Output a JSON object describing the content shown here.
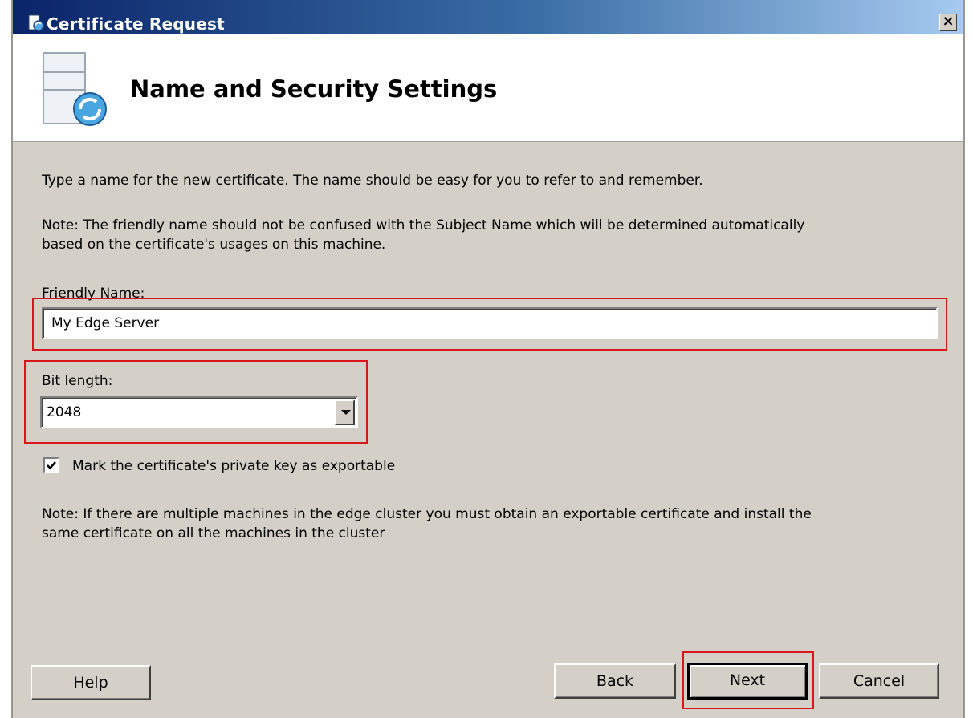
{
  "window": {
    "title": "Certificate Request",
    "close_label": "×"
  },
  "header": {
    "title": "Name and Security Settings"
  },
  "body": {
    "intro": "Type a name for the new certificate. The name should be easy for you to refer to and remember.",
    "note1_line1": "Note: The friendly name should not be confused with the Subject Name which will be determined automatically",
    "note1_line2": "based on the certificate's usages on this machine.",
    "friendly_name_label": "Friendly Name:",
    "friendly_name_value": "My Edge Server",
    "bit_length_label": "Bit length:",
    "bit_length_value": "2048",
    "exportable_label": "Mark the certificate's private key as exportable",
    "exportable_checked": true,
    "note2_line1": "Note: If there are multiple machines in the edge cluster you must obtain an exportable certificate and install the",
    "note2_line2": "same certificate on all the machines in the cluster"
  },
  "buttons": {
    "help": "Help",
    "back": "Back",
    "next": "Next",
    "cancel": "Cancel"
  },
  "colors": {
    "highlight": "#d9161c",
    "dialog_bg": "#d4d0c8",
    "titlebar_start": "#0a246a"
  }
}
